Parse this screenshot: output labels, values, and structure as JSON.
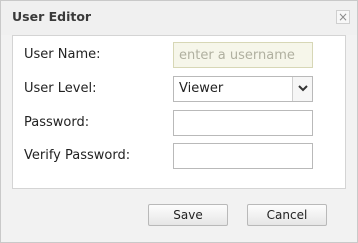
{
  "dialog": {
    "title": "User Editor",
    "close_label": "×"
  },
  "form": {
    "username_label": "User Name:",
    "username_placeholder": "enter a username",
    "username_value": "",
    "level_label": "User Level:",
    "level_selected": "Viewer",
    "password_label": "Password:",
    "password_value": "",
    "verify_label": "Verify Password:",
    "verify_value": ""
  },
  "buttons": {
    "save": "Save",
    "cancel": "Cancel"
  },
  "icons": {
    "close": "close-icon",
    "dropdown": "chevron-down-icon"
  }
}
